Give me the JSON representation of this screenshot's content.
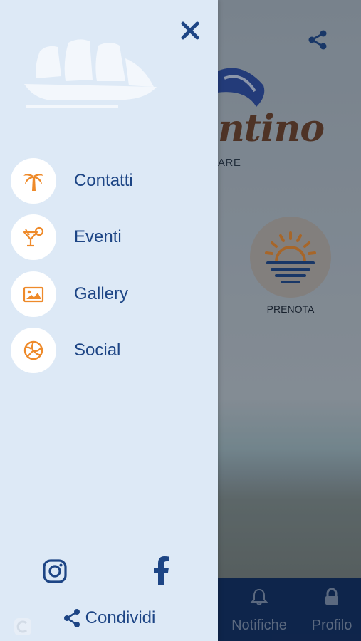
{
  "background": {
    "logo_text": "ntino",
    "subtitle": "ARE",
    "prenota_label": "PRENOTA",
    "tabbar": {
      "notifiche_label": "Notifiche",
      "profilo_label": "Profilo"
    },
    "icons": [
      "share-icon",
      "sun-icon",
      "bell-icon",
      "lock-icon"
    ]
  },
  "drawer": {
    "close_icon": "close-icon",
    "menu": [
      {
        "label": "Contatti",
        "icon": "palm-tree-icon"
      },
      {
        "label": "Eventi",
        "icon": "cocktail-icon"
      },
      {
        "label": "Gallery",
        "icon": "image-icon"
      },
      {
        "label": "Social",
        "icon": "volleyball-icon"
      }
    ],
    "footer": {
      "instagram_icon": "instagram-icon",
      "facebook_icon": "facebook-icon",
      "share_label": "Condividi"
    }
  },
  "colors": {
    "drawer_bg": "#dde9f6",
    "accent_blue": "#1d4585",
    "icon_orange": "#ee8a2a",
    "tabbar_bg": "#0c2a5c"
  }
}
